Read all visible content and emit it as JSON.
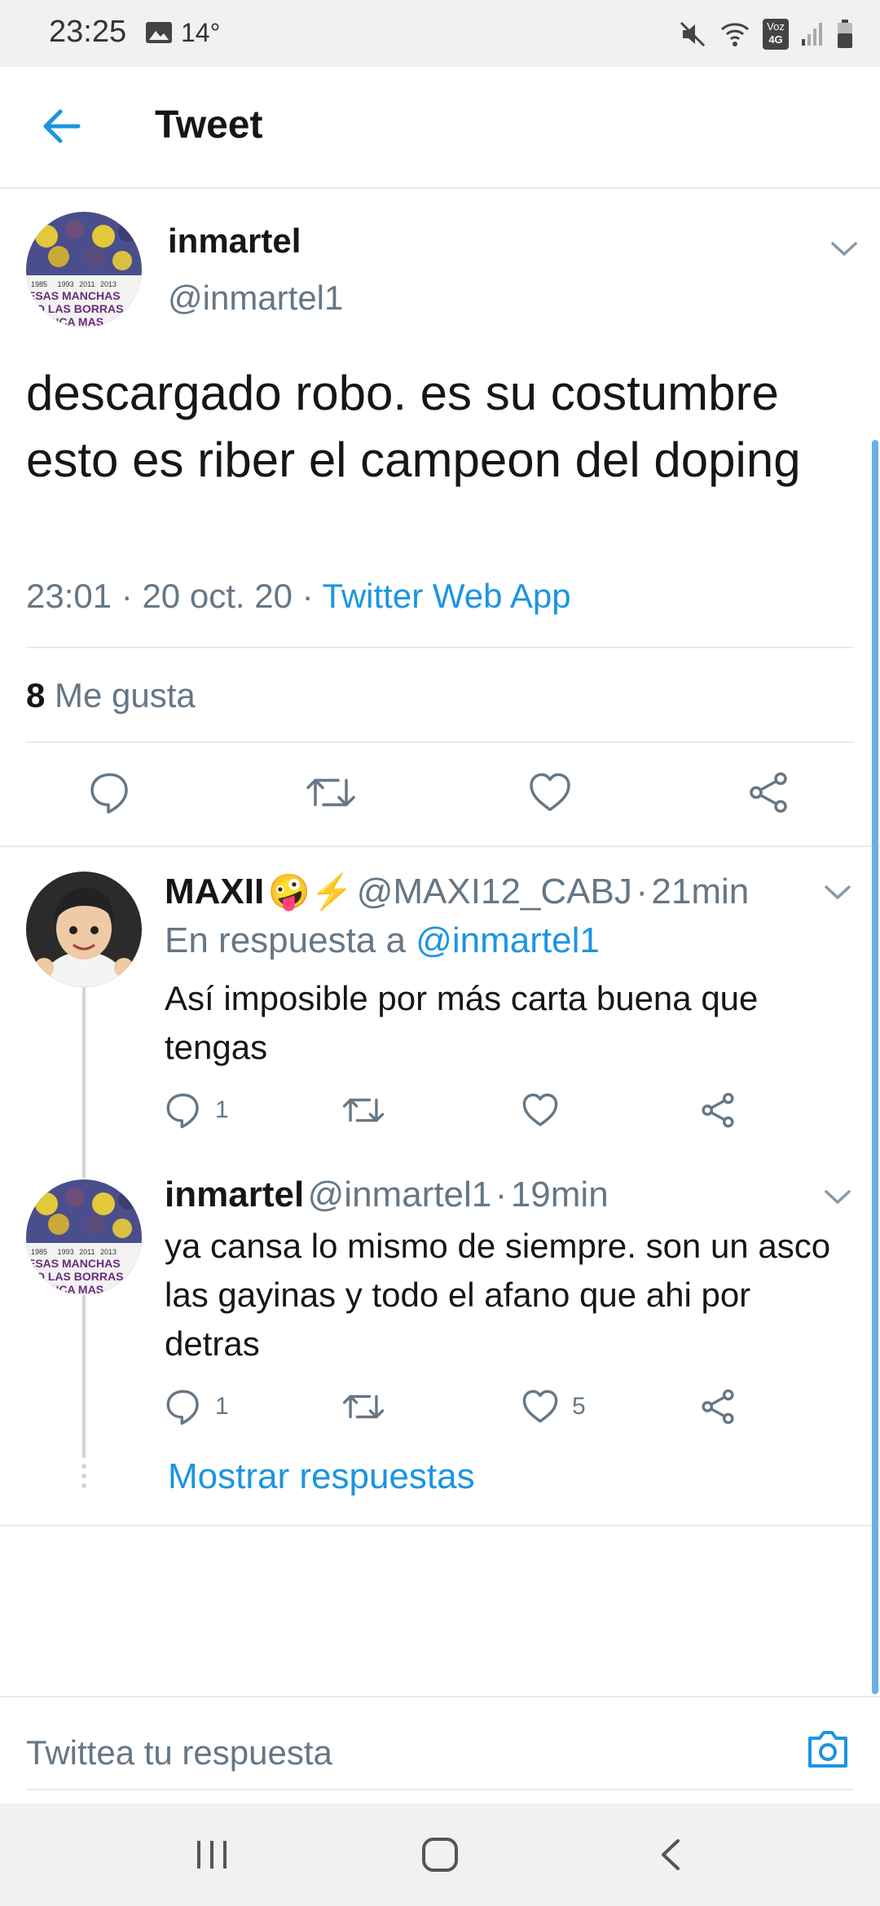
{
  "status_bar": {
    "time": "23:25",
    "temperature": "14°",
    "network_label_top": "Voz",
    "network_label_bottom": "4G",
    "icons": [
      "image-icon",
      "mute-icon",
      "wifi-icon",
      "signal-icon",
      "battery-icon"
    ]
  },
  "toolbar": {
    "title": "Tweet",
    "back_icon": "arrow-left-icon"
  },
  "tweet": {
    "author_name": "inmartel",
    "author_handle": "@inmartel1",
    "text": "descargado robo. es su costumbre esto es riber el campeon del doping",
    "time": "23:01",
    "date": "20 oct. 20",
    "source": "Twitter Web App",
    "separator": "·",
    "likes_count": "8",
    "likes_label": "Me gusta",
    "avatar_banner_text": [
      "1985",
      "1993",
      "2011",
      "2013",
      "ESAS MANCHAS",
      "NO LAS BORRAS",
      "NUNCA MAS"
    ]
  },
  "replies": [
    {
      "name": "MAXII",
      "emoji": "🤪⚡",
      "handle": "@MAXI12_CABJ",
      "time": "21min",
      "in_reply_prefix": "En respuesta a",
      "in_reply_handle": "@inmartel1",
      "text": "Así imposible por más carta buena que tengas",
      "reply_count": "1",
      "retweet_count": "",
      "like_count": ""
    },
    {
      "name": "inmartel",
      "handle": "@inmartel1",
      "time": "19min",
      "text": "ya cansa lo mismo de siempre. son un asco las gayinas y todo el afano que ahi por detras",
      "reply_count": "1",
      "retweet_count": "",
      "like_count": "5"
    }
  ],
  "show_replies": "Mostrar respuestas",
  "composer": {
    "placeholder": "Twittea tu respuesta"
  },
  "colors": {
    "accent": "#1b95e0",
    "text": "#14171a",
    "muted": "#657786",
    "divider": "#e6ecf0"
  }
}
